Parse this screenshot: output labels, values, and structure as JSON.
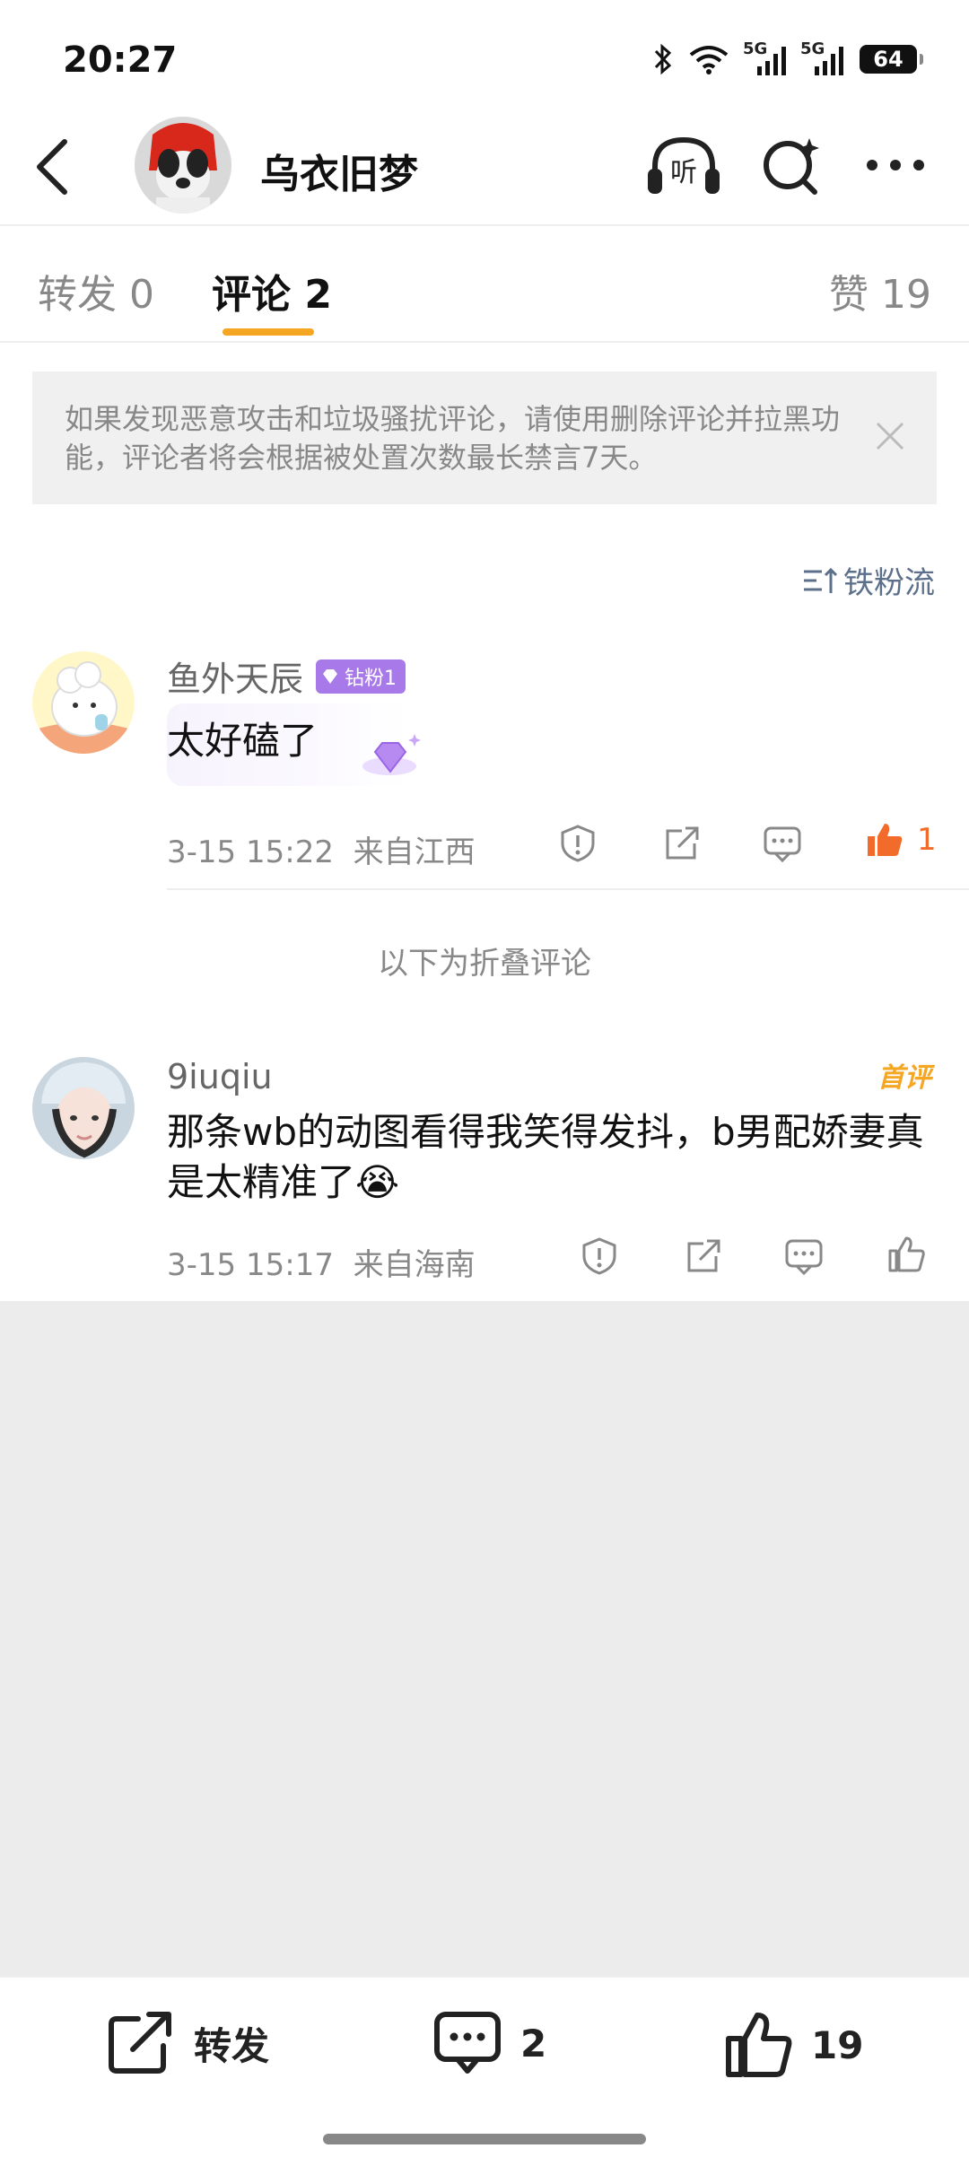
{
  "status_bar": {
    "time": "20:27",
    "net1": "5G",
    "net2": "5G",
    "battery": "64"
  },
  "header": {
    "user_name": "乌衣旧梦",
    "listen_label": "听"
  },
  "tabs": {
    "repost_label": "转发 0",
    "comment_label": "评论 2",
    "like_label": "赞 19"
  },
  "notice": {
    "text": "如果发现恶意攻击和垃圾骚扰评论，请使用删除评论并拉黑功能，评论者将会根据被处置次数最长禁言7天。"
  },
  "sort": {
    "label": "铁粉流"
  },
  "comments": [
    {
      "username": "鱼外天辰",
      "badge": "钻粉1",
      "text": "太好磕了",
      "time": "3-15 15:22",
      "location": "来自江西",
      "likes": "1"
    },
    {
      "username": "9iuqiu",
      "tag": "首评",
      "text": "那条wb的动图看得我笑得发抖，b男配娇妻真是太精准了😭",
      "time": "3-15 15:17",
      "location": "来自海南"
    }
  ],
  "folded_label": "以下为折叠评论",
  "bottom_bar": {
    "repost": "转发",
    "comments": "2",
    "likes": "19"
  },
  "colors": {
    "accent": "#f5a623",
    "link": "#5c6f8b",
    "like_active": "#f26b2a",
    "badge": "#a879e8"
  }
}
